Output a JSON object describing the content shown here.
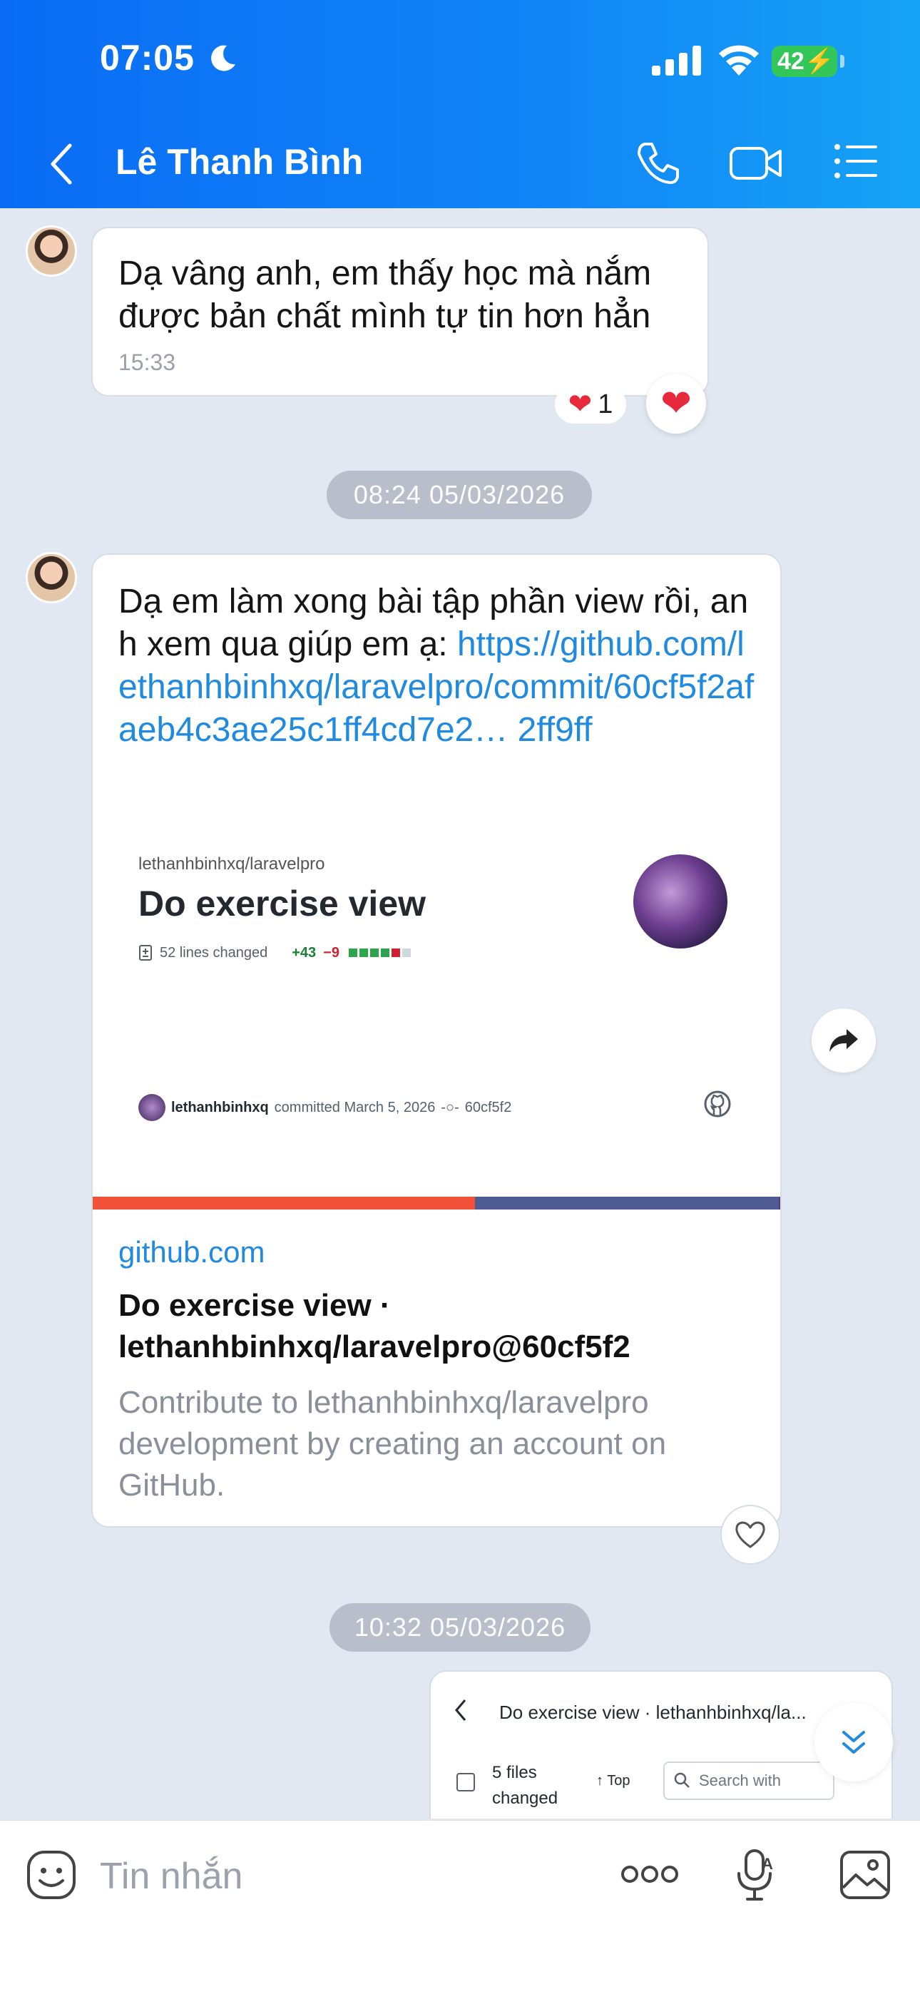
{
  "status_bar": {
    "time": "07:05",
    "battery": "42"
  },
  "header": {
    "title": "Lê Thanh Bình"
  },
  "messages": {
    "msg1": {
      "text": "Dạ vâng anh, em thấy học mà nắm được bản chất mình tự tin hơn hẳn",
      "time": "15:33",
      "reaction_count": "1"
    },
    "divider1": "08:24 05/03/2026",
    "msg2": {
      "text_prefix": "Dạ em làm xong bài tập phần view rồi, anh xem qua giúp em ạ: ",
      "link": "https://github.com/lethanhbinhxq/laravelpro/commit/60cf5f2afaeb4c3ae25c1ff4cd7e2… 2ff9ff",
      "preview": {
        "repo_owner": "lethanhbinhxq/laravelpro",
        "repo_title": "Do exercise view",
        "lines_changed": "52 lines changed",
        "additions": "+43",
        "deletions": "−9",
        "commit_author": "lethanhbinhxq",
        "commit_info": "committed March 5, 2026",
        "commit_hash": "60cf5f2"
      },
      "domain": "github.com",
      "link_title": "Do exercise view · lethanhbinhxq/laravelpro@60cf5f2",
      "link_desc": "Contribute to lethanhbinhxq/laravelpro development by creating an account on GitHub."
    },
    "divider2": "10:32 05/03/2026",
    "msg3": {
      "title": "Do exercise view · lethanhbinhxq/la...",
      "files_changed": "5 files changed",
      "top_label": "Top",
      "search_placeholder": "Search with"
    }
  },
  "input": {
    "placeholder": "Tin nhắn"
  },
  "colors": {
    "header_start": "#0a6cf5",
    "header_end": "#16a3f5",
    "link": "#1f8ae0",
    "chat_bg": "#e2e8f1"
  }
}
